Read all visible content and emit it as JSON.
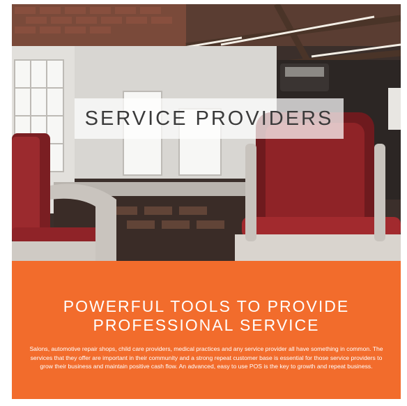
{
  "hero": {
    "title": "SERVICE PROVIDERS"
  },
  "section": {
    "headline_line1": "POWERFUL TOOLS TO PROVIDE",
    "headline_line2": "PROFESSIONAL SERVICE",
    "body": "Salons, automotive repair shops, child care providers, medical practices and any service provider all have something in common. The services that they offer are important in their community and a strong repeat customer base is essential for those service providers to grow their business and maintain positive cash flow. An advanced, easy to use POS is the key to growth and repeat business."
  },
  "colors": {
    "accent": "#f26c2c",
    "title_box": "#ffffffb8"
  }
}
